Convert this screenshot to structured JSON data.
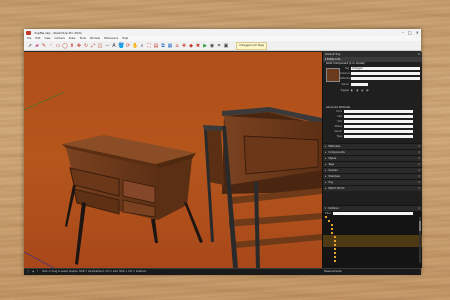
{
  "window": {
    "title": "dupfile.skp - SketchUp Pro 2021",
    "controls": [
      "–",
      "□",
      "✕"
    ]
  },
  "menu": [
    "File",
    "Edit",
    "View",
    "Camera",
    "Draw",
    "Tools",
    "Window",
    "Extensions",
    "Help"
  ],
  "toolbar": {
    "icons": [
      "select-icon",
      "eraser-icon",
      "line-icon",
      "arc-icon",
      "rectangle-icon",
      "circle-icon",
      "pushpull-icon",
      "move-icon",
      "rotate-icon",
      "scale-icon",
      "offset-icon",
      "tape-icon",
      "text-icon",
      "paint-icon",
      "orbit-icon",
      "pan-icon",
      "zoom-icon",
      "zoom-extents-icon",
      "layers-icon",
      "section-icon",
      "sandbox-icon",
      "warehouse-icon",
      "extension-icon",
      "ruby-icon",
      "x-icon",
      "play-icon",
      "camera-icon",
      "measure-icon",
      "photo-icon"
    ],
    "tag_dropdown": "Untagged (All Tags)"
  },
  "panel": {
    "title": "Default Tray",
    "entity_info": {
      "header": "Entity Info",
      "subheader": "Solid Component (1 in model)",
      "swatch_color": "#6a3a1c",
      "tag_label": "Tag",
      "tag_value": "Untagged",
      "instance_label": "Instance",
      "instance_value": "",
      "definition_label": "Definition",
      "definition_value": "",
      "owner_label": "Owner",
      "owner_value": "",
      "toggles_label": "Toggles",
      "advanced_header": "Advanced Attributes",
      "advanced_rows": [
        {
          "label": "Price",
          "value": ""
        },
        {
          "label": "Size",
          "value": ""
        },
        {
          "label": "URL",
          "value": ""
        },
        {
          "label": "Status",
          "value": ""
        },
        {
          "label": "Owner",
          "value": ""
        },
        {
          "label": "Type",
          "value": ""
        }
      ]
    },
    "sections": [
      "Materials",
      "Components",
      "Styles",
      "Tags",
      "Scenes",
      "Shadows",
      "Fog",
      "Match Photo"
    ],
    "outliner": {
      "header": "Outliner",
      "filter_label": "Filter:",
      "items": [
        "",
        "",
        "",
        "",
        "",
        "",
        "",
        "",
        "",
        "",
        "",
        ""
      ]
    }
  },
  "status": {
    "hint": "Click or drag to select objects. Shift = Add/Subtract. Ctrl = Add. Shift + Ctrl = Subtract.",
    "measurements_label": "Measurements"
  },
  "colors": {
    "floor": "#b5521a",
    "wood": "#6e3a17",
    "wood_dark": "#4a2510",
    "leg": "#1c1512",
    "desk_background": "#c9a070"
  }
}
